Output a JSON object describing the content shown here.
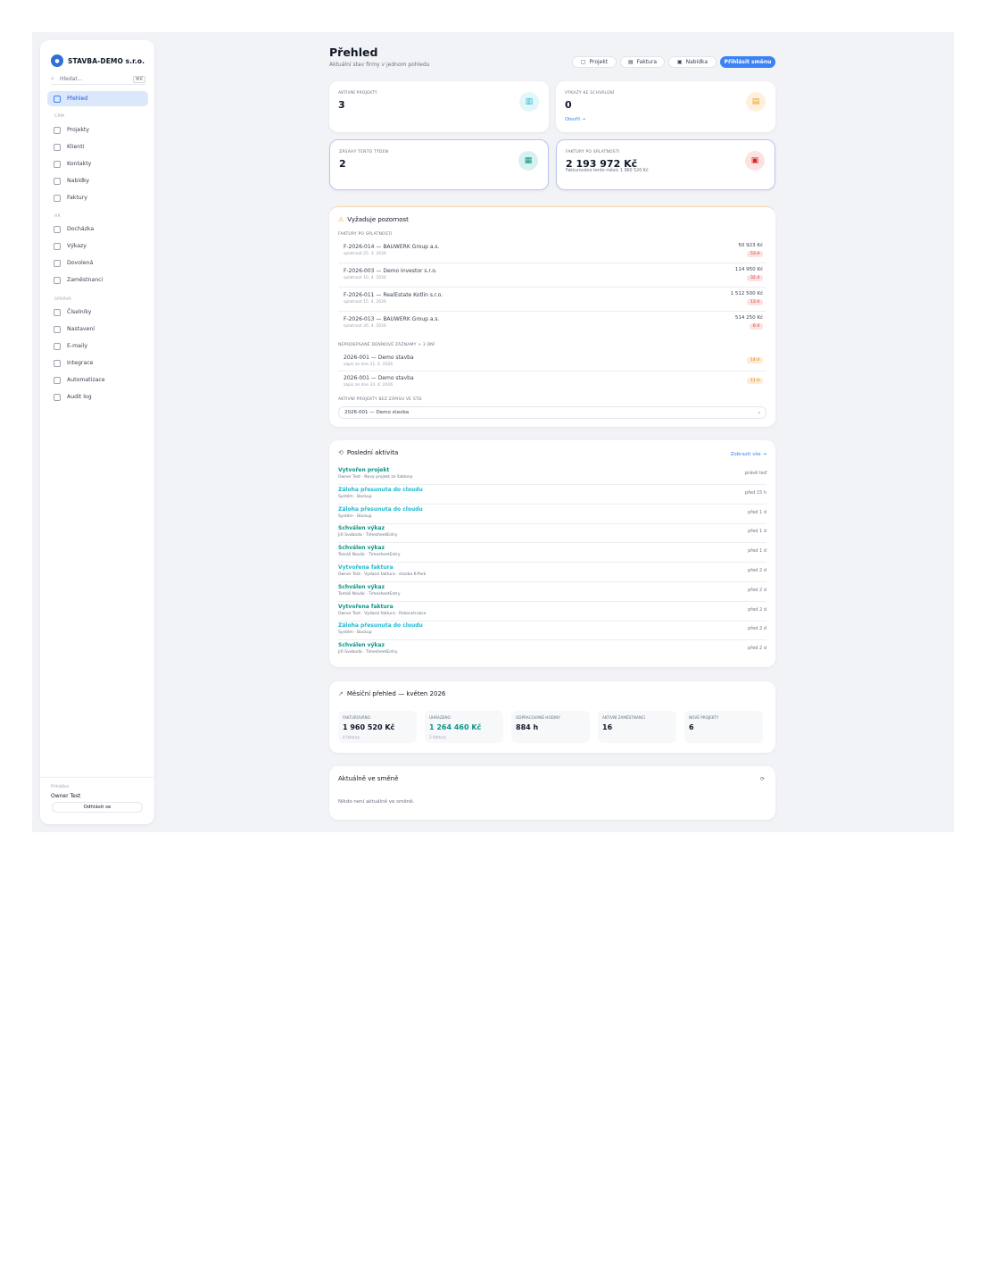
{
  "sidebar": {
    "brand": "STAVBA-DEMO s.r.o.",
    "logo_letter": "●",
    "search_placeholder": "Hledat...",
    "search_kbd": "⌘K",
    "items": [
      {
        "label": "Přehled",
        "icon": "grid-icon",
        "active": true
      },
      {
        "label": "Projekty",
        "icon": "building-icon"
      },
      {
        "label": "Klienti",
        "icon": "clients-icon"
      },
      {
        "label": "Kontakty",
        "icon": "contact-icon"
      },
      {
        "label": "Nabídky",
        "icon": "offer-icon"
      },
      {
        "label": "Faktury",
        "icon": "invoice-icon"
      },
      {
        "label": "Docházka",
        "icon": "clock-icon"
      },
      {
        "label": "Výkazy",
        "icon": "report-icon"
      },
      {
        "label": "Dovolená",
        "icon": "calendar-icon"
      },
      {
        "label": "Zaměstnanci",
        "icon": "people-icon"
      },
      {
        "label": "Číselníky",
        "icon": "apps-icon"
      },
      {
        "label": "Nastavení",
        "icon": "gear-icon"
      },
      {
        "label": "E-maily",
        "icon": "mail-icon"
      },
      {
        "label": "Integrace",
        "icon": "plug-icon"
      },
      {
        "label": "Automatizace",
        "icon": "flow-icon"
      },
      {
        "label": "Audit log",
        "icon": "history-icon"
      }
    ],
    "sections": [
      "CRM",
      "HR",
      "SPRÁVA"
    ],
    "user_label": "Přihlášen",
    "user_name": "Owner Test",
    "logout": "Odhlásit se"
  },
  "header": {
    "title": "Přehled",
    "subtitle": "Aktuální stav firmy v jednom pohledu",
    "buttons": [
      "Projekt",
      "Faktura",
      "Nabídka",
      "Přihlásit směnu"
    ]
  },
  "stats": [
    {
      "label": "AKTIVNÍ PROJEKTY",
      "value": "3",
      "color": "#22b8cf",
      "bg": "#e3f6fa",
      "icon": "building-icon"
    },
    {
      "label": "VÝKAZY KE SCHVÁLENÍ",
      "value": "0",
      "color": "#f59e0b",
      "bg": "#fdf1dd",
      "icon": "clipboard-icon",
      "link": "Otevřít →"
    },
    {
      "label": "ZÁSAHY TENTO TÝDEN",
      "value": "2",
      "color": "#0d9488",
      "bg": "#d7f2ee",
      "icon": "calendar-icon"
    },
    {
      "label": "FAKTURY PO SPLATNOSTI",
      "value": "2 193 972 Kč",
      "color": "#dc2626",
      "bg": "#fde2e2",
      "icon": "invoice-icon",
      "sub": "Fakturováno tento měsíc 1 960 520 Kč"
    }
  ],
  "attention": {
    "title": "Vyžaduje pozornost",
    "overdue_head": "FAKTURY PO SPLATNOSTI",
    "overdue": [
      {
        "title": "F-2026-014 — BAUWERK Group a.s.",
        "sub": "splatnost 25. 3. 2026",
        "amount": "50 923 Kč",
        "badge": "53 d"
      },
      {
        "title": "F-2026-003 — Demo Investor s.r.o.",
        "sub": "splatnost 10. 4. 2026",
        "amount": "114 950 Kč",
        "badge": "32 d"
      },
      {
        "title": "F-2026-011 — RealEstate Kotlin s.r.o.",
        "sub": "splatnost 15. 4. 2026",
        "amount": "1 512 500 Kč",
        "badge": "13 d"
      },
      {
        "title": "F-2026-013 — BAUWERK Group a.s.",
        "sub": "splatnost 26. 4. 2026",
        "amount": "514 250 Kč",
        "badge": "6 d"
      }
    ],
    "stale_head": "NEPODEPSANÉ DENÍKOVÉ ZÁZNAMY > 3 DNÍ",
    "stale": [
      {
        "title": "2026-001 — Demo stavba",
        "sub": "zápis ze dne 21. 4. 2026",
        "badge": "14 d"
      },
      {
        "title": "2026-001 — Demo stavba",
        "sub": "zápis ze dne 24. 4. 2026",
        "badge": "11 d"
      }
    ],
    "nb_head": "AKTIVNÍ PROJEKTY BEZ ZÁPISU VE STD",
    "nb_row": "2026-001 — Demo stavba"
  },
  "activity": {
    "title": "Poslední aktivita",
    "all_link": "Zobrazit vše →",
    "items": [
      {
        "title": "Vytvořen projekt",
        "sub": "Owner Test · Nový projekt ze šablony",
        "when": "právě teď",
        "color": "#0d9488"
      },
      {
        "title": "Záloha přesunuta do cloudu",
        "sub": "Systém · Backup",
        "when": "před 15 h",
        "color": "#22b8cf"
      },
      {
        "title": "Záloha přesunuta do cloudu",
        "sub": "Systém · Backup",
        "when": "před 1 d",
        "color": "#22b8cf"
      },
      {
        "title": "Schválen výkaz",
        "sub": "Jiří Svoboda · TimesheetEntry",
        "when": "před 1 d",
        "color": "#0d9488"
      },
      {
        "title": "Schválen výkaz",
        "sub": "Tomáš Novák · TimesheetEntry",
        "when": "před 1 d",
        "color": "#0d9488"
      },
      {
        "title": "Vytvořena faktura",
        "sub": "Owner Test · Vydaná faktura · stavba K-Park",
        "when": "před 2 d",
        "color": "#22b8cf"
      },
      {
        "title": "Schválen výkaz",
        "sub": "Tomáš Novák · TimesheetEntry",
        "when": "před 2 d",
        "color": "#0d9488"
      },
      {
        "title": "Vytvořena faktura",
        "sub": "Owner Test · Vydaná faktura · Rekonstrukce",
        "when": "před 2 d",
        "color": "#0d9488"
      },
      {
        "title": "Záloha přesunuta do cloudu",
        "sub": "Systém · Backup",
        "when": "před 2 d",
        "color": "#22b8cf"
      },
      {
        "title": "Schválen výkaz",
        "sub": "Jiří Svoboda · TimesheetEntry",
        "when": "před 2 d",
        "color": "#0d9488"
      }
    ]
  },
  "month": {
    "title": "Měsíční přehled — květen 2026",
    "cells": [
      {
        "label": "FAKTUROVÁNO",
        "value": "1 960 520 Kč",
        "note": "4 faktury"
      },
      {
        "label": "UHRAZENO",
        "value": "1 264 460 Kč",
        "note": "2 faktury",
        "green": true
      },
      {
        "label": "ODPRACOVANÉ HODINY",
        "value": "884 h",
        "note": ""
      },
      {
        "label": "AKTIVNÍ ZAMĚSTNANCI",
        "value": "16",
        "note": ""
      },
      {
        "label": "NOVÉ PROJEKTY",
        "value": "6",
        "note": ""
      }
    ]
  },
  "shift": {
    "title": "Aktuálně ve směně",
    "empty": "Nikdo není aktuálně ve směně.",
    "refresh": "⟳"
  }
}
